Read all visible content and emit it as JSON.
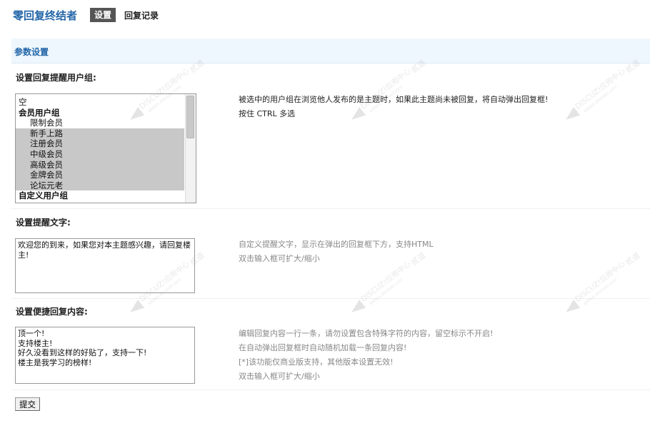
{
  "header": {
    "title": "零回复终结者",
    "tab_active": "设置",
    "tab_other": "回复记录"
  },
  "section": {
    "title": "参数设置"
  },
  "usergroups": {
    "label": "设置回复提醒用户组:",
    "options": [
      {
        "text": "空",
        "type": "plain",
        "selected": false
      },
      {
        "text": "会员用户组",
        "type": "group",
        "selected": false
      },
      {
        "text": "限制会员",
        "type": "indent",
        "selected": false
      },
      {
        "text": "新手上路",
        "type": "indent",
        "selected": true
      },
      {
        "text": "注册会员",
        "type": "indent",
        "selected": true
      },
      {
        "text": "中级会员",
        "type": "indent",
        "selected": true
      },
      {
        "text": "高级会员",
        "type": "indent",
        "selected": true
      },
      {
        "text": "金牌会员",
        "type": "indent",
        "selected": true
      },
      {
        "text": "论坛元老",
        "type": "indent",
        "selected": true
      },
      {
        "text": "自定义用户组",
        "type": "group",
        "selected": false
      }
    ],
    "note1": "被选中的用户组在浏览他人发布的是主题时，如果此主题尚未被回复，将自动弹出回复框!",
    "note2": "按住 CTRL 多选"
  },
  "reminder": {
    "label": "设置提醒文字:",
    "value": "欢迎您的到来，如果您对本主题感兴趣，请回复楼主!",
    "note1": "自定义提醒文字，显示在弹出的回复框下方，支持HTML",
    "note2": "双击输入框可扩大/缩小"
  },
  "quickreply": {
    "label": "设置便捷回复内容:",
    "value": "顶一个!\n支持楼主!\n好久没看到这样的好贴了，支持一下!\n楼主是我学习的榜样!",
    "note1": "编辑回复内容一行一条，请勿设置包含特殊字符的内容，留空标示不开启!",
    "note2": "在自动弹出回复框时自动随机加载一条回复内容!",
    "note3": "[*]该功能仅商业版支持，其他版本设置无效!",
    "note4": "双击输入框可扩大/缩小"
  },
  "submit": {
    "label": "提交"
  },
  "watermark": {
    "line1": "DISCUZ!应用中心",
    "line2": "addon.dismall.com",
    "mark": "贰道"
  }
}
